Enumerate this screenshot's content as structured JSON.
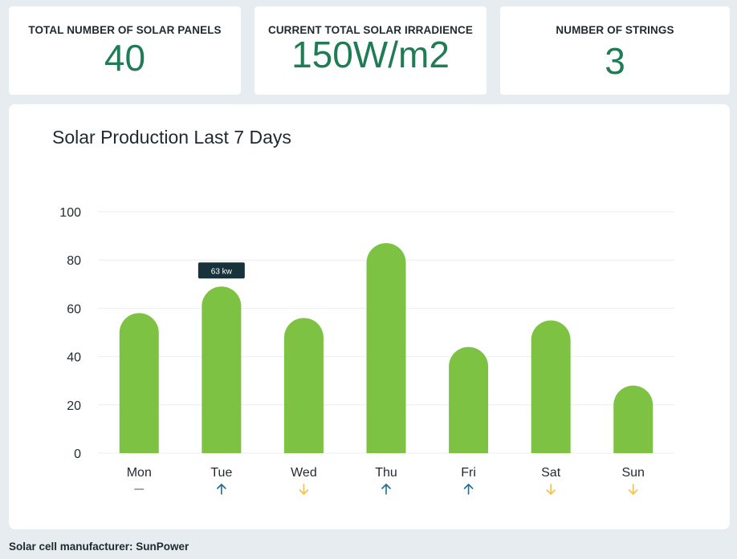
{
  "stats": [
    {
      "label": "TOTAL NUMBER OF SOLAR PANELS",
      "value": "40"
    },
    {
      "label": "CURRENT TOTAL SOLAR IRRADIENCE",
      "value": "150W/m2"
    },
    {
      "label": "NUMBER OF STRINGS",
      "value": "3"
    }
  ],
  "chart_data": {
    "type": "bar",
    "title": "Solar Production Last 7 Days",
    "categories": [
      "Mon",
      "Tue",
      "Wed",
      "Thu",
      "Fri",
      "Sat",
      "Sun"
    ],
    "values": [
      58,
      69,
      56,
      87,
      44,
      55,
      28
    ],
    "ylim": [
      0,
      100
    ],
    "yticks": [
      0,
      20,
      40,
      60,
      80,
      100
    ],
    "grid": true,
    "trends": [
      "flat",
      "up",
      "down",
      "up",
      "up",
      "down",
      "down"
    ],
    "tooltip": {
      "category": "Tue",
      "text": "63 kw"
    },
    "colors": {
      "bar": "#7dc243",
      "up": "#1b6f94",
      "down": "#f2c14e",
      "flat": "#a8a8a8",
      "tooltip_bg": "#17323a"
    }
  },
  "footer": {
    "text": "Solar cell manufacturer: SunPower"
  }
}
